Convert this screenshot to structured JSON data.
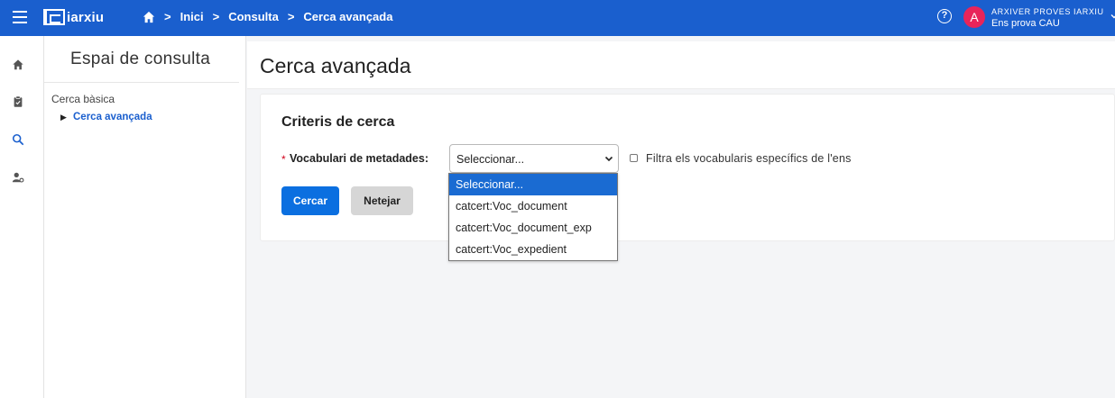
{
  "app": {
    "logo_text": "iarxiu"
  },
  "breadcrumb": {
    "items": [
      "Inici",
      "Consulta",
      "Cerca avançada"
    ],
    "separator": ">"
  },
  "user": {
    "initial": "A",
    "name": "ARXIVER PROVES IARXIU",
    "org": "Ens prova CAU"
  },
  "topbar": {
    "help_glyph": "?"
  },
  "side_panel": {
    "title": "Espai de consulta",
    "items": [
      "Cerca bàsica",
      "Cerca avançada"
    ],
    "active_marker": "▶"
  },
  "page": {
    "title": "Cerca avançada"
  },
  "search_form": {
    "section_title": "Criteris de cerca",
    "required_mark": "*",
    "vocab_label": "Vocabulari de metadades:",
    "vocab_value": "Seleccionar...",
    "filter_label": "Filtra els vocabularis específics de l'ens",
    "search_button": "Cercar",
    "clear_button": "Netejar"
  },
  "dropdown": {
    "options": [
      "Seleccionar...",
      "catcert:Voc_document",
      "catcert:Voc_document_exp",
      "catcert:Voc_expedient"
    ]
  },
  "colors": {
    "topbar": "#1a5fce",
    "accent": "#0b6fe0",
    "avatar": "#e8245a",
    "option_selected": "#1a6bd2"
  },
  "icons": [
    "menu-icon",
    "home-icon",
    "help-icon",
    "clipboard-icon",
    "search-icon",
    "user-settings-icon",
    "chevron-down-icon"
  ]
}
